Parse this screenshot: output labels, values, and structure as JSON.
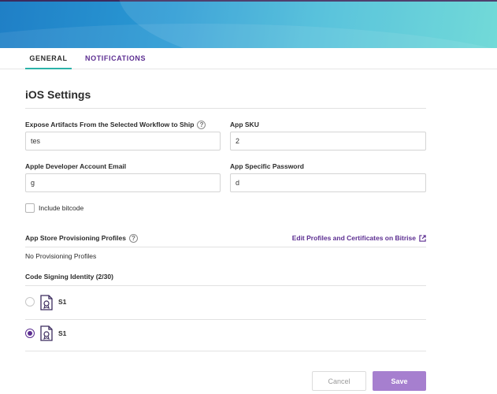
{
  "tabs": [
    {
      "label": "GENERAL",
      "active": true
    },
    {
      "label": "NOTIFICATIONS",
      "active": false
    }
  ],
  "section": {
    "title": "iOS Settings"
  },
  "fields": {
    "expose_artifacts": {
      "label": "Expose Artifacts From the Selected Workflow to Ship",
      "value": "tes"
    },
    "app_sku": {
      "label": "App SKU",
      "value": "2"
    },
    "apple_email": {
      "label": "Apple Developer Account Email",
      "value": "g"
    },
    "app_password": {
      "label": "App Specific Password",
      "value": "d"
    }
  },
  "include_bitcode": {
    "label": "Include bitcode",
    "checked": false
  },
  "provisioning": {
    "label": "App Store Provisioning Profiles",
    "edit_link": "Edit Profiles and Certificates on Bitrise",
    "empty_text": "No Provisioning Profiles"
  },
  "signing": {
    "label": "Code Signing Identity (2/30)",
    "identities": [
      {
        "name": "S1",
        "selected": false
      },
      {
        "name": "S1",
        "selected": true
      }
    ]
  },
  "actions": {
    "cancel_label": "Cancel",
    "save_label": "Save"
  },
  "colors": {
    "accent": "#5c2e91",
    "tab_underline": "#2bb2a8",
    "save_bg": "#a67fcf"
  }
}
